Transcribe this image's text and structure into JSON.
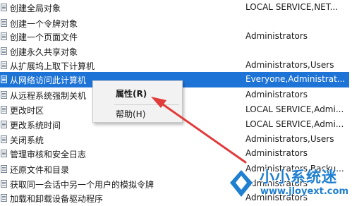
{
  "policies": [
    {
      "name": "创建全局对象",
      "security": "LOCAL SERVICE,NET..."
    },
    {
      "name": "创建一个令牌对象",
      "security": ""
    },
    {
      "name": "创建一个页面文件",
      "security": "Administrators"
    },
    {
      "name": "创建永久共享对象",
      "security": ""
    },
    {
      "name": "从扩展坞上取下计算机",
      "security": "Administrators,Users"
    },
    {
      "name": "从网络访问此计算机",
      "security": "Everyone,Administrat..."
    },
    {
      "name": "从远程系统强制关机",
      "security": "Administrators"
    },
    {
      "name": "更改时区",
      "security": "LOCAL SERVICE,Admi..."
    },
    {
      "name": "更改系统时间",
      "security": "LOCAL SERVICE,Admi..."
    },
    {
      "name": "关闭系统",
      "security": "Administrators,Users"
    },
    {
      "name": "管理审核和安全日志",
      "security": "Administrators"
    },
    {
      "name": "还原文件和目录",
      "security": "Administrators,Backu..."
    },
    {
      "name": "获取同一会话中另一个用户的模拟令牌",
      "security": "Administrators"
    },
    {
      "name": "加载和卸载设备驱动程序",
      "security": "Administrators"
    }
  ],
  "context_menu": {
    "properties": "属性(R)",
    "help": "帮助(H)"
  },
  "watermark": {
    "name": "小小系统迷",
    "url": "www.jloyext.com"
  },
  "colors": {
    "selection": "#1e73d6",
    "arrow": "#e23b3b",
    "watermark": "#1f7fd0"
  }
}
